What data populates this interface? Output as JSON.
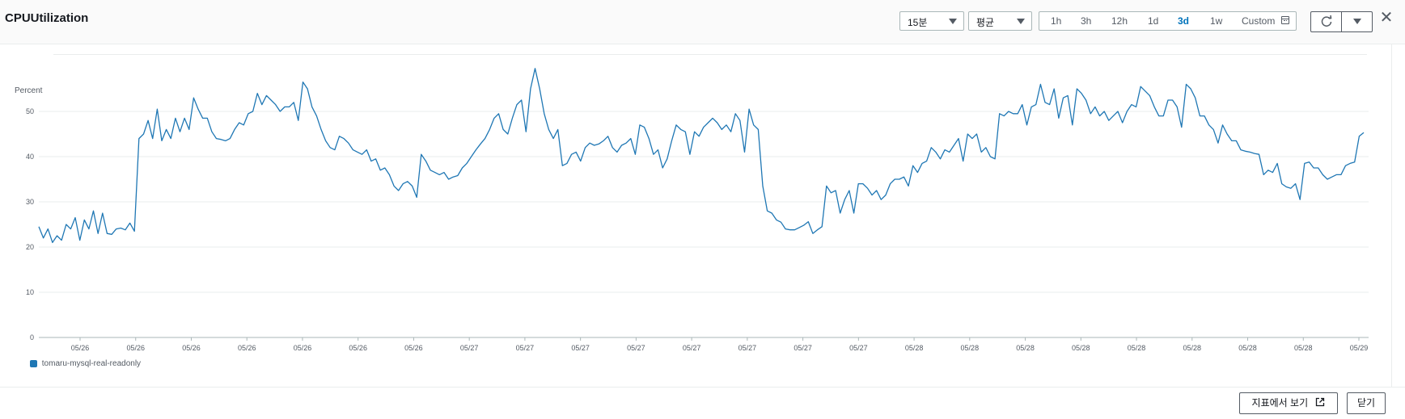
{
  "header": {
    "title": "CPUUtilization",
    "period_select": "15분",
    "stat_select": "평균",
    "ranges": [
      "1h",
      "3h",
      "12h",
      "1d",
      "3d",
      "1w"
    ],
    "active_range": "3d",
    "custom_label": "Custom"
  },
  "footer": {
    "view_in_metrics": "지표에서 보기",
    "close": "닫기"
  },
  "legend": {
    "series_name": "tomaru-mysql-real-readonly",
    "color": "#1f77b4"
  },
  "chart_data": {
    "type": "line",
    "ylabel": "Percent",
    "ylim": [
      0,
      60
    ],
    "yticks": [
      0,
      10,
      20,
      30,
      40,
      50
    ],
    "xtick_labels": [
      "05/26",
      "05/26",
      "05/26",
      "05/26",
      "05/26",
      "05/26",
      "05/26",
      "05/27",
      "05/27",
      "05/27",
      "05/27",
      "05/27",
      "05/27",
      "05/27",
      "05/27",
      "05/28",
      "05/28",
      "05/28",
      "05/28",
      "05/28",
      "05/28",
      "05/28",
      "05/28",
      "05/29"
    ],
    "grid": true,
    "series": [
      {
        "name": "tomaru-mysql-real-readonly",
        "color": "#1f77b4",
        "values": [
          24.5,
          22,
          24,
          21,
          22.5,
          21.5,
          25,
          24,
          26.5,
          21.5,
          26,
          24,
          28,
          23,
          27.5,
          23,
          22.8,
          24,
          24.2,
          23.8,
          25.3,
          23.5,
          44,
          45,
          48,
          44,
          50.5,
          43.5,
          46,
          44,
          48.5,
          45.5,
          48.5,
          46,
          53,
          50.5,
          48.5,
          48.5,
          45.5,
          44,
          43.8,
          43.5,
          44,
          46,
          47.5,
          47,
          49.5,
          50,
          54,
          51.5,
          53.5,
          52.5,
          51.5,
          50,
          51,
          51,
          52,
          48,
          56.5,
          55,
          51,
          49,
          46,
          43.5,
          42,
          41.5,
          44.5,
          44,
          43,
          41.5,
          41,
          40.5,
          41.5,
          39,
          39.5,
          37,
          37.5,
          36,
          33.5,
          32.5,
          34,
          34.5,
          33.5,
          31,
          40.5,
          39,
          37,
          36.5,
          36,
          36.5,
          35,
          35.5,
          35.8,
          37.5,
          38.5,
          40,
          41.5,
          42.8,
          44,
          46,
          48.5,
          49.5,
          46,
          45,
          48.5,
          51.5,
          52.5,
          45.5,
          55,
          59.5,
          55,
          49.5,
          46,
          44,
          46,
          38,
          38.5,
          40.5,
          41,
          39,
          42,
          43,
          42.5,
          42.8,
          43.5,
          44.5,
          42,
          41,
          42.5,
          43,
          44,
          40.5,
          47,
          46.5,
          44,
          40.5,
          41.5,
          37.5,
          39.5,
          43.5,
          47,
          46,
          45.5,
          40.5,
          45.5,
          44.5,
          46.5,
          47.5,
          48.5,
          47.5,
          46,
          47,
          45.5,
          49.5,
          48,
          41,
          50.5,
          47,
          46,
          33.5,
          28,
          27.5,
          26,
          25.5,
          24,
          23.8,
          23.8,
          24.3,
          24.8,
          25.6,
          23,
          23.8,
          24.5,
          33.5,
          32,
          32.5,
          27.5,
          30.5,
          32.5,
          27.5,
          34,
          34,
          33,
          31.5,
          32.5,
          30.5,
          31.5,
          34,
          35,
          35,
          35.5,
          33.5,
          38,
          36.5,
          38.5,
          39,
          42,
          41,
          39.5,
          41.5,
          41,
          42.5,
          44,
          39,
          45,
          44,
          45,
          41,
          42,
          40,
          39.5,
          49.5,
          49,
          50,
          49.5,
          49.5,
          51.5,
          47,
          51,
          51.5,
          56,
          52,
          51.5,
          55,
          48.5,
          53,
          53.5,
          47,
          55,
          54,
          52.5,
          49.5,
          51,
          49,
          50,
          48,
          49,
          50,
          47.5,
          50,
          51.5,
          51,
          55.5,
          54.5,
          53.5,
          51,
          49,
          49,
          52.5,
          52.5,
          51,
          46.5,
          56,
          55,
          53,
          49,
          49,
          47,
          46,
          43,
          47,
          45,
          43.5,
          43.5,
          41.5,
          41.2,
          41,
          40.7,
          40.5,
          36,
          37,
          36.5,
          38.5,
          34,
          33.3,
          33,
          34,
          30.5,
          38.5,
          38.8,
          37.5,
          37.5,
          36,
          35,
          35.5,
          36,
          36,
          38,
          38.5,
          38.8,
          44.5,
          45.3
        ]
      }
    ]
  }
}
